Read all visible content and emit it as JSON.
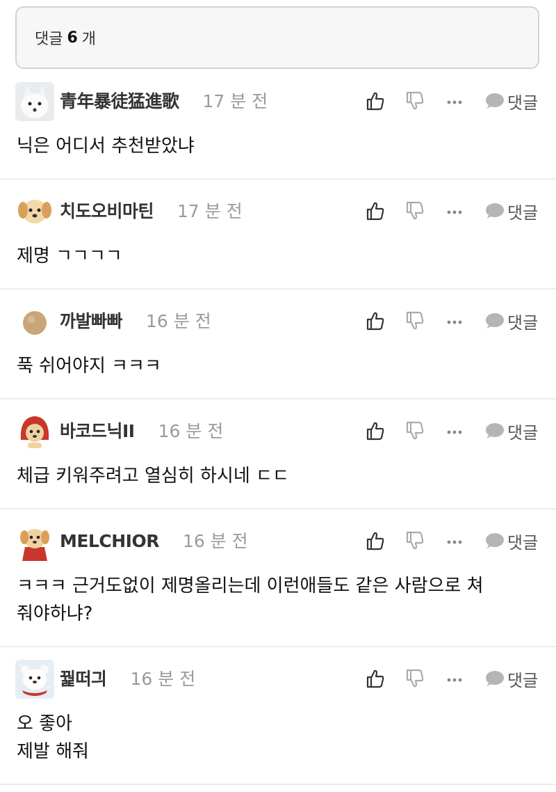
{
  "header": {
    "label": "댓글",
    "count": "6",
    "unit": "개"
  },
  "actions": {
    "reply_label": "댓글"
  },
  "comments": [
    {
      "nickname": "青年暴徒猛進歌",
      "time": "17 분 전",
      "text": "닉은 어디서 추천받았냐",
      "avatar": "white-fox-avatar"
    },
    {
      "nickname": "치도오비마틴",
      "time": "17 분 전",
      "text": "제명 ㄱㄱㄱㄱ",
      "avatar": "puppy-avatar"
    },
    {
      "nickname": "까발빠빠",
      "time": "16 분 전",
      "text": "푹 쉬어야지 ㅋㅋㅋ",
      "avatar": "ball-avatar"
    },
    {
      "nickname": "바코드닉II",
      "time": "16 분 전",
      "text": "체급 키워주려고 열심히 하시네 ㄷㄷ",
      "avatar": "red-hood-puppy-avatar"
    },
    {
      "nickname": "MELCHIOR",
      "time": "16 분 전",
      "text": "ㅋㅋㅋ 근거도없이 제명올리는데 이런애들도 같은 사람으로 쳐\n줘야하냐?",
      "avatar": "red-cape-puppy-avatar"
    },
    {
      "nickname": "꿡떠긔",
      "time": "16 분 전",
      "text": "오 좋아\n제발 해줘",
      "avatar": "snow-bear-avatar"
    }
  ]
}
